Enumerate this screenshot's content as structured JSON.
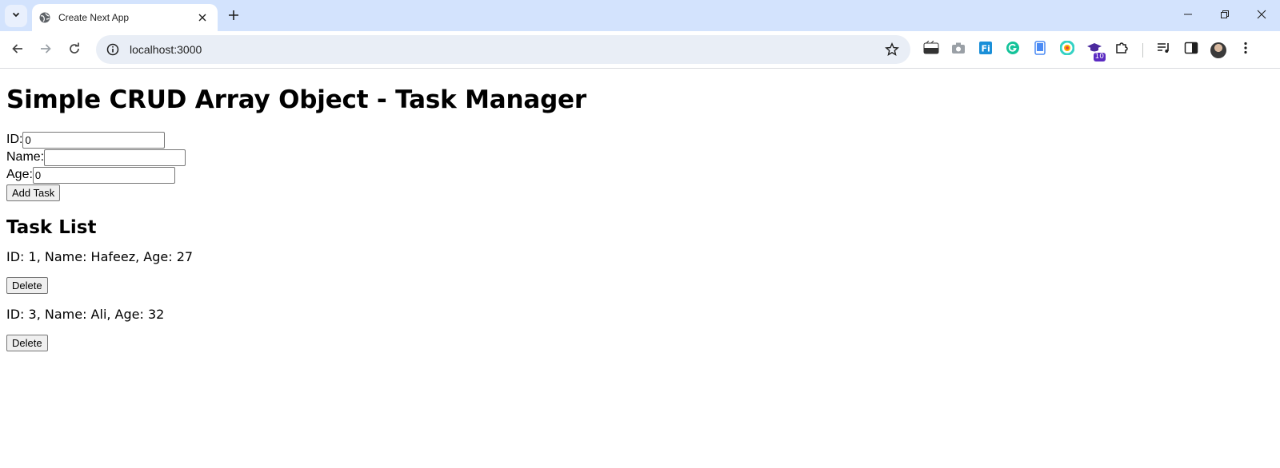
{
  "browser": {
    "tab_title": "Create Next App",
    "url": "localhost:3000",
    "extension_badge": "10",
    "icons": [
      "tab-search-icon",
      "globe-icon",
      "close-icon",
      "plus-icon",
      "minimize-icon",
      "restore-icon",
      "window-close-icon",
      "back-icon",
      "forward-icon",
      "reload-icon",
      "info-icon",
      "star-icon",
      "extensions-icon",
      "reading-list-icon",
      "side-panel-icon",
      "more-icon"
    ]
  },
  "page": {
    "title": "Simple CRUD Array Object - Task Manager",
    "form": {
      "id_label": "ID:",
      "id_value": "0",
      "name_label": "Name:",
      "name_value": "",
      "age_label": "Age:",
      "age_value": "0",
      "add_button": "Add Task"
    },
    "list_heading": "Task List",
    "tasks": [
      {
        "text": "ID: 1, Name: Hafeez, Age: 27",
        "delete_label": "Delete"
      },
      {
        "text": "ID: 3, Name: Ali, Age: 32",
        "delete_label": "Delete"
      }
    ]
  }
}
